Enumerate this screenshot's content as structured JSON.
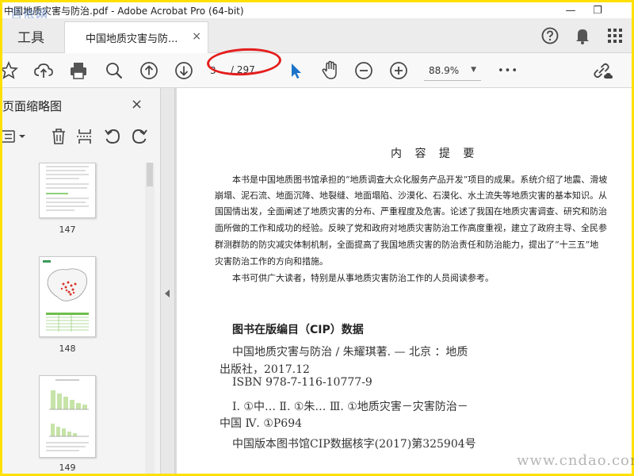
{
  "window": {
    "title": "中国地质灾害与防治.pdf - Adobe Acrobat Pro (64-bit)",
    "watermark_top": "百依网",
    "minimize": "—",
    "restore": "❐"
  },
  "tabs": {
    "tools_label": "工具",
    "doc_label": "中国地质灾害与防...",
    "close_glyph": "×"
  },
  "toolbar": {
    "current_page": "3",
    "page_total": "/ 297",
    "zoom": "88.9%",
    "more": "•••"
  },
  "sidebar": {
    "title": "页面缩略图",
    "close_glyph": "×",
    "thumbnails": [
      {
        "label": "147"
      },
      {
        "label": "148"
      },
      {
        "label": "149"
      }
    ]
  },
  "document": {
    "heading": "内 容 提 要",
    "summary_lines": [
      "本书是中国地质图书馆承担的“地质调查大众化服务产品开发”项目的成果。系统介绍了地震、滑坡",
      "崩塌、泥石流、地面沉降、地裂缝、地面塌陷、沙漠化、石漠化、水土流失等地质灾害的基本知识。从",
      "国国情出发，全面阐述了地质灾害的分布、严重程度及危害。论述了我国在地质灾害调查、研究和防治",
      "面所做的工作和成功的经验。反映了党和政府对地质灾害防治工作高度重视，建立了政府主导、全民参",
      "群测群防的防灾减灾体制机制，全面提高了我国地质灾害的防治责任和防治能力，提出了“十三五”地",
      "灾害防治工作的方向和措施。"
    ],
    "audience_line": "本书可供广大读者，特别是从事地质灾害防治工作的人员阅读参考。",
    "cip_title": "图书在版编目（CIP）数据",
    "cip_lines": [
      "中国地质灾害与防治 / 朱耀琪著. — 北京 ：地质",
      "出版社，2017.12",
      "ISBN 978-7-116-10777-9",
      "Ⅰ. ①中… Ⅱ. ①朱… Ⅲ. ①地质灾害－灾害防治－",
      "中国 Ⅳ. ①P694",
      "中国版本图书馆CIP数据核字(2017)第325904号"
    ]
  },
  "watermark_bottom": "www.cndao.com",
  "colors": {
    "frame": "#ffe000",
    "annotation_ellipse": "#e41e1e",
    "select_cursor": "#1a73c9"
  }
}
